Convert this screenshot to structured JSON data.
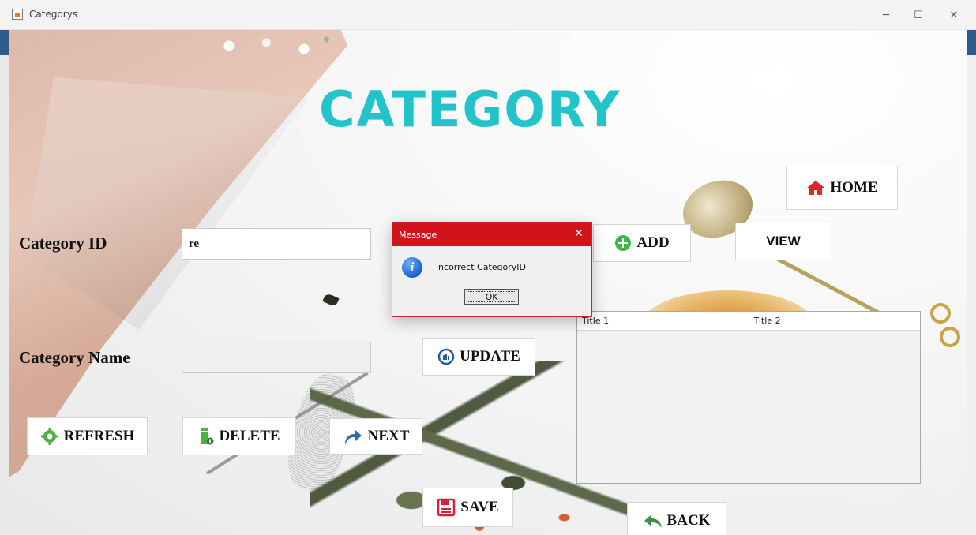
{
  "window": {
    "title": "Categorys",
    "minimize_label": "─",
    "maximize_label": "☐",
    "close_label": "✕"
  },
  "header": {
    "title": "CATEGORY"
  },
  "form": {
    "category_id_label": "Category ID",
    "category_id_value": "re",
    "category_name_label": "Category Name",
    "category_name_value": ""
  },
  "buttons": {
    "home": "HOME",
    "add": "ADD",
    "view": "VIEW",
    "update": "UPDATE",
    "refresh": "REFRESH",
    "delete": "DELETE",
    "next": "NEXT",
    "save": "SAVE",
    "back": "BACK"
  },
  "table": {
    "columns": [
      "Title 1",
      "Title 2"
    ]
  },
  "dialog": {
    "title": "Message",
    "message": "incorrect CategoryID",
    "ok_label": "OK",
    "close_label": "✕",
    "icon_glyph": "i"
  },
  "colors": {
    "title_accent": "#22c3c9",
    "dialog_title_bg": "#d1141c",
    "home_icon": "#e0262b",
    "add_icon": "#3fb649",
    "refresh_icon": "#4bb23e",
    "delete_icon": "#4bb23e",
    "next_icon": "#2e6fb5",
    "save_icon": "#d61f3b",
    "back_icon": "#3f8d4b",
    "update_icon": "#1f5fa8"
  },
  "icons": {
    "home": "house-icon",
    "add": "plus-circle-icon",
    "update": "update-icon",
    "refresh": "gear-refresh-icon",
    "delete": "trash-icon",
    "next": "forward-arrow-icon",
    "save": "floppy-disk-icon",
    "back": "reply-arrow-icon",
    "dialog": "info-icon"
  }
}
